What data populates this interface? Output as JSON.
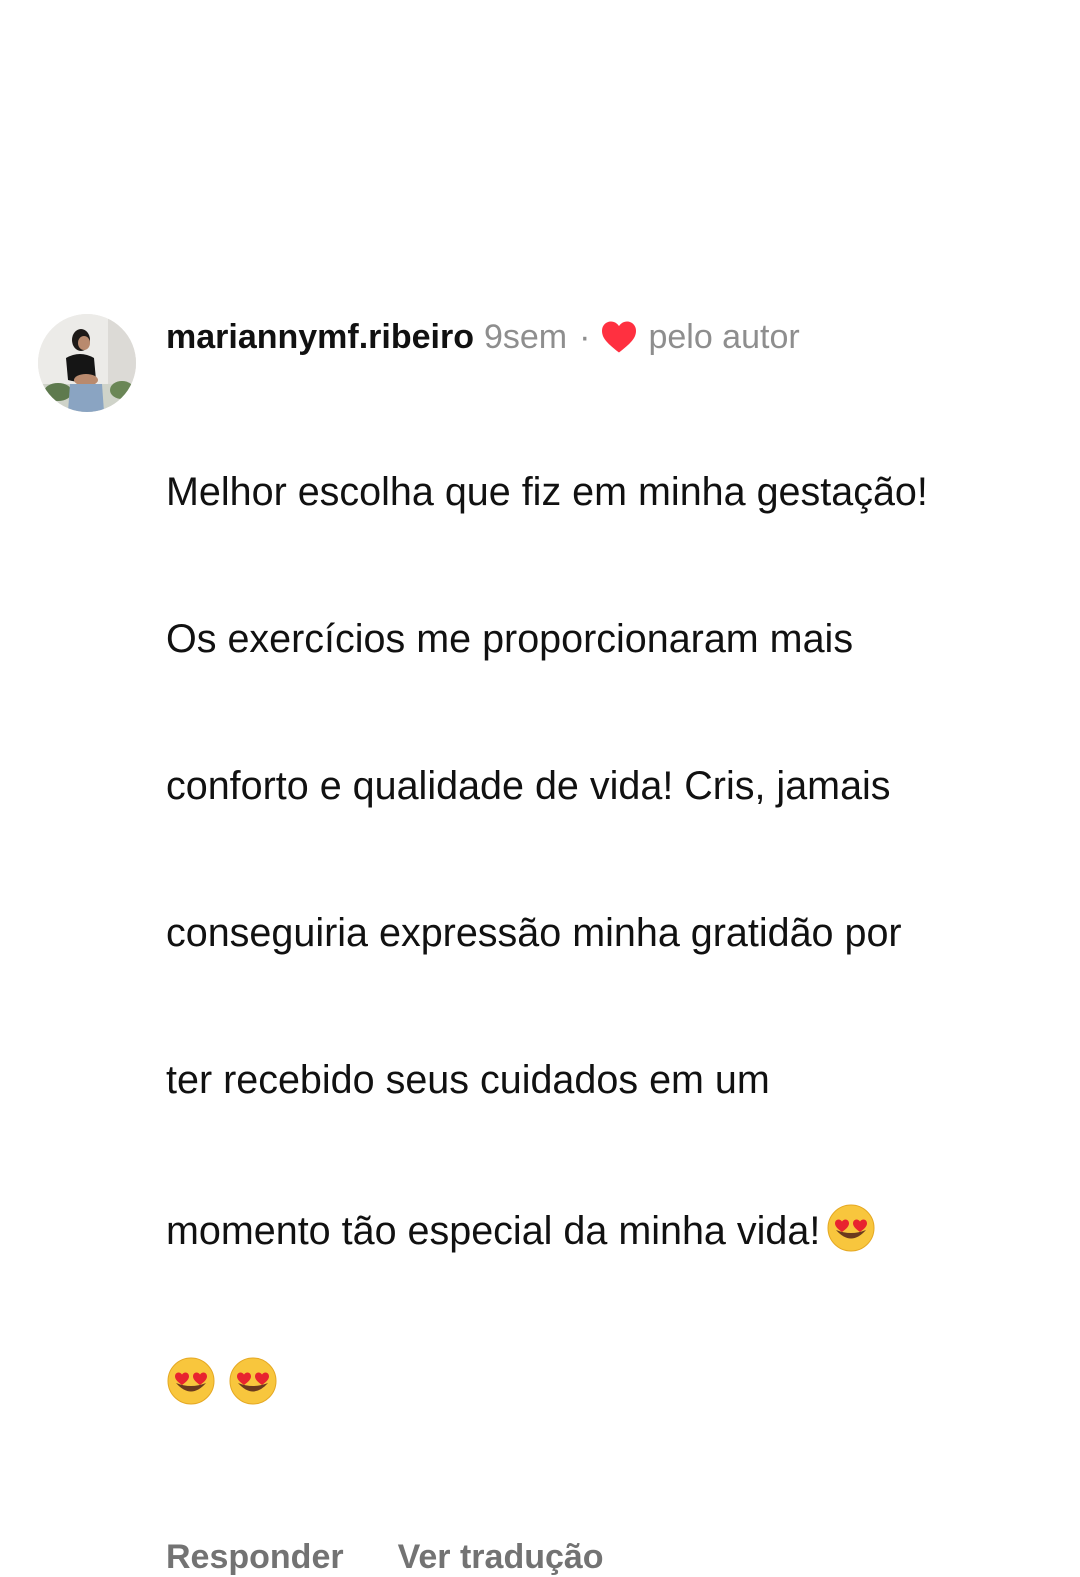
{
  "comment": {
    "username": "mariannymf.ribeiro",
    "time": "9sem",
    "separator": "·",
    "liked_label": "pelo autor",
    "liked_icon": "heart-icon",
    "heart_color": "#ff3040",
    "text_line_1": "Melhor escolha que fiz em minha gestação!",
    "text_line_2": "Os exercícios me proporcionaram mais",
    "text_line_3": "conforto e qualidade de vida! Cris, jamais",
    "text_line_4": "conseguiria expressão minha gratidão por",
    "text_line_5": "ter recebido seus cuidados em um",
    "text_line_6": "momento tão especial da minha vida!",
    "emoji": "smiling-face-with-heart-eyes",
    "actions": {
      "reply": "Responder",
      "translate": "Ver tradução"
    }
  }
}
